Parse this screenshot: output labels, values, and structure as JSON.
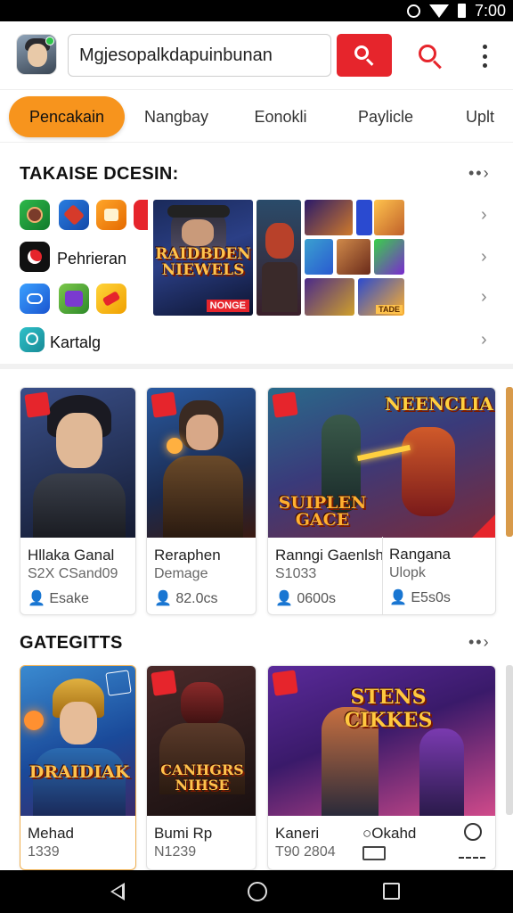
{
  "status_bar": {
    "time": "7:00"
  },
  "header": {
    "search_value": "Mgjesopalkdapuinbunan"
  },
  "tabs": [
    {
      "label": "Pencakain",
      "active": true
    },
    {
      "label": "Nangbay",
      "active": false
    },
    {
      "label": "Eonokli",
      "active": false
    },
    {
      "label": "Paylicle",
      "active": false
    },
    {
      "label": "Uplt",
      "active": false
    }
  ],
  "section1": {
    "title": "TAKAISE DCESIN:",
    "more": "••›",
    "list": [
      {
        "label": ""
      },
      {
        "label": "Pehrieran"
      },
      {
        "label": ""
      },
      {
        "label": "Kartalg"
      }
    ],
    "banner_text": "RAIDBDEN NIEWELS",
    "banner_tag": "NONGE",
    "mini_tag": "TADE"
  },
  "section2": {
    "cards": [
      {
        "title": "Hllaka Ganal",
        "sub": "S2X CSand09",
        "meta": " ¦  ",
        "meta_text": "Esake"
      },
      {
        "title": "Reraphen",
        "sub": "Demage",
        "meta_text": "82.0cs"
      },
      {
        "title": "Ranngi Gaenlsh",
        "sub": "S1033",
        "meta_text": "0600s",
        "banner": "NEENCLIA",
        "banner2": "SUIPLEN GACE"
      },
      {
        "title": "Rangana",
        "sub": "Ulopk",
        "meta_text": "E5s0s"
      }
    ]
  },
  "section3": {
    "title": "GATEGITTS",
    "more": "••›",
    "cards": [
      {
        "title": "Mehad",
        "sub": "1339",
        "banner": "DRAIDIAK"
      },
      {
        "title": "Bumi Rp",
        "sub": "N1239",
        "banner": "CANHGRS NIHSE"
      },
      {
        "title": "Kaneri",
        "sub": "T90 2804",
        "extra": "Okahd",
        "banner": "STENS CIKKES"
      }
    ]
  },
  "colors": {
    "accent": "#e6252c",
    "tab_active": "#f7941d"
  }
}
